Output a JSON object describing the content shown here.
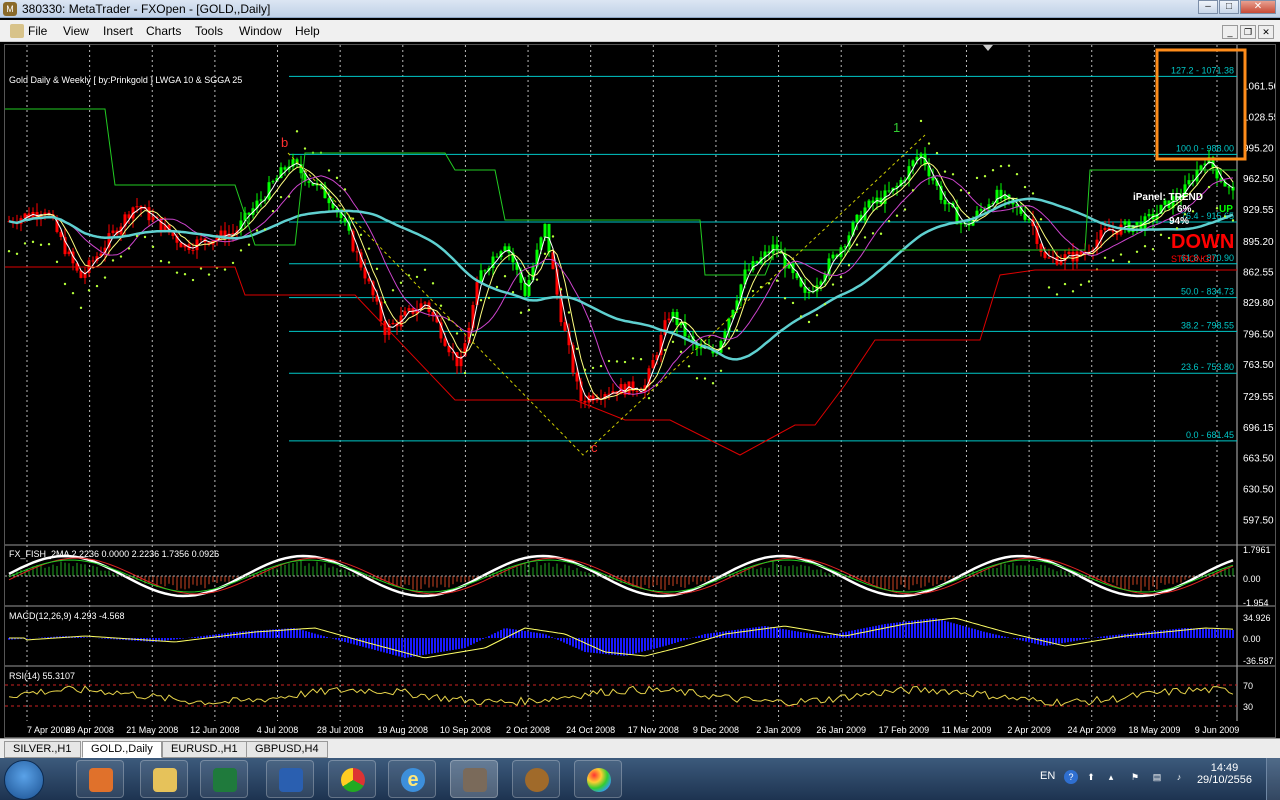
{
  "window": {
    "title": "380330: MetaTrader - FXOpen - [GOLD,,Daily]",
    "icon": "M"
  },
  "menu": [
    "File",
    "View",
    "Insert",
    "Charts",
    "Tools",
    "Window",
    "Help"
  ],
  "chart": {
    "title": "Gold Daily & Weekly [ by:Prinkgold ] LWGA 10  &  SGGA 25",
    "price_ticks": [
      "1061.50",
      "1028.55",
      "995.20",
      "962.50",
      "929.55",
      "895.20",
      "862.55",
      "829.80",
      "796.50",
      "763.50",
      "729.55",
      "696.15",
      "663.50",
      "630.50",
      "597.50"
    ],
    "fib_levels": [
      {
        "label": "127.2 - 1071.38",
        "price": 1071.38
      },
      {
        "label": "100.0 - 988.00",
        "price": 988.0
      },
      {
        "label": "76.4 - 915.65",
        "price": 915.65
      },
      {
        "label": "61.8 - 870.90",
        "price": 870.9
      },
      {
        "label": "50.0 - 834.73",
        "price": 834.73
      },
      {
        "label": "38.2 - 798.55",
        "price": 798.55
      },
      {
        "label": "23.6 - 753.80",
        "price": 753.8
      },
      {
        "label": "0.0 - 681.45",
        "price": 681.45
      }
    ],
    "wave_labels": [
      "b",
      "c",
      "1"
    ],
    "ipanel": {
      "title": "iPanel: TREND",
      "percent": "6%",
      "up_label": "UP",
      "value": "94%",
      "down_label": "DOWN",
      "strength": "STRONG!!"
    },
    "dates": [
      "7 Apr 2008",
      "29 Apr 2008",
      "21 May 2008",
      "12 Jun 2008",
      "4 Jul 2008",
      "28 Jul 2008",
      "19 Aug 2008",
      "10 Sep 2008",
      "2 Oct 2008",
      "24 Oct 2008",
      "17 Nov 2008",
      "9 Dec 2008",
      "2 Jan 2009",
      "26 Jan 2009",
      "17 Feb 2009",
      "11 Mar 2009",
      "2 Apr 2009",
      "24 Apr 2009",
      "18 May 2009",
      "9 Jun 2009"
    ],
    "fisher": {
      "label": "FX_FISH_2MA 2.2236 0.0000 2.2236 1.7356 0.0926",
      "ticks": [
        "1.7961",
        "0.00",
        "-1.954"
      ]
    },
    "macd": {
      "label": "MACD(12,26,9) 4.293 -4.568",
      "ticks": [
        "34.926",
        "0.00",
        "-36.587"
      ]
    },
    "rsi": {
      "label": "RSI(14) 55.3107",
      "ticks": [
        "70",
        "30"
      ]
    }
  },
  "tabs": [
    "SILVER.,H1",
    "GOLD.,Daily",
    "EURUSD.,H1",
    "GBPUSD,H4"
  ],
  "active_tab": 1,
  "taskbar": {
    "apps": [
      "media-player",
      "file-manager",
      "excel",
      "word",
      "chrome",
      "internet-explorer",
      "metatrader",
      "media-app",
      "paint"
    ]
  },
  "tray": {
    "lang": "EN",
    "time": "14:49",
    "date": "29/10/2556"
  },
  "colors": {
    "bull": "#00ff00",
    "bear": "#ff0000",
    "fib": "#00c8c8",
    "ma_white": "#ffffff",
    "ma_yellow": "#ffff80",
    "ma_magenta": "#cc44cc",
    "ma_cyan": "#5fd0d0",
    "highlight": "#ff8c1a",
    "macd_hist": "#1a1aff"
  }
}
